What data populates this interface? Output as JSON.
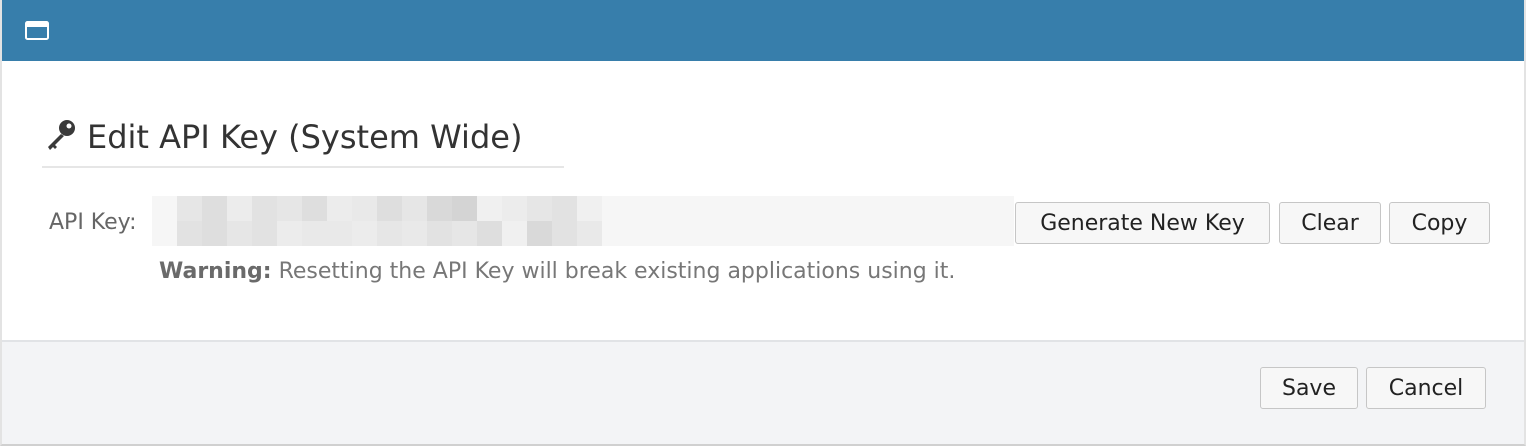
{
  "titlebar": {
    "icon": "window-icon",
    "color": "#377eab"
  },
  "heading": {
    "icon": "key-icon",
    "text": "Edit API Key (System Wide)"
  },
  "api_key": {
    "label": "API Key:",
    "value": "",
    "buttons": {
      "generate": "Generate New Key",
      "clear": "Clear",
      "copy": "Copy"
    },
    "warning_bold": "Warning:",
    "warning_text": " Resetting the API Key will break existing applications using it."
  },
  "footer": {
    "save": "Save",
    "cancel": "Cancel"
  }
}
